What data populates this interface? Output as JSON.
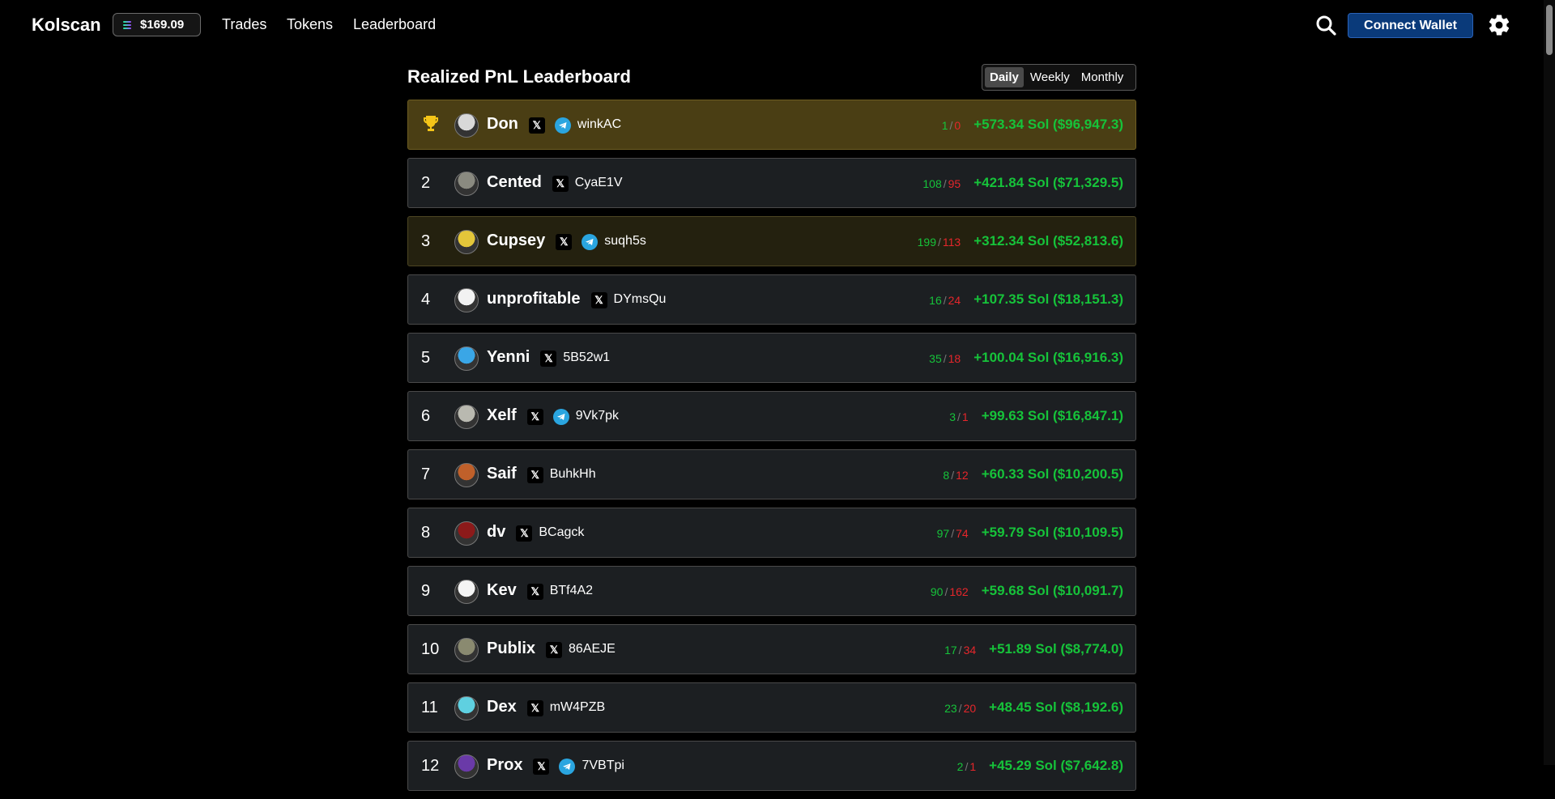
{
  "app": {
    "brand": "Kolscan",
    "sol_price": "$169.09"
  },
  "nav": [
    "Trades",
    "Tokens",
    "Leaderboard"
  ],
  "header": {
    "connect_label": "Connect Wallet"
  },
  "leaderboard": {
    "title": "Realized PnL Leaderboard",
    "periods": [
      "Daily",
      "Weekly",
      "Monthly"
    ],
    "active_period": "Daily",
    "rows": [
      {
        "rank": "1",
        "name": "Don",
        "x": true,
        "tg": true,
        "wallet": "winkAC",
        "wins": "1",
        "losses": "0",
        "pnl": "+573.34 Sol ($96,947.3)",
        "style": "gold",
        "avatar_color": "#d8d8d8"
      },
      {
        "rank": "2",
        "name": "Cented",
        "x": true,
        "tg": false,
        "wallet": "CyaE1V",
        "wins": "108",
        "losses": "95",
        "pnl": "+421.84 Sol ($71,329.5)",
        "style": "normal",
        "avatar_color": "#8a8a80"
      },
      {
        "rank": "3",
        "name": "Cupsey",
        "x": true,
        "tg": true,
        "wallet": "suqh5s",
        "wins": "199",
        "losses": "113",
        "pnl": "+312.34 Sol ($52,813.6)",
        "style": "olive",
        "avatar_color": "#e3c63a"
      },
      {
        "rank": "4",
        "name": "unprofitable",
        "x": true,
        "tg": false,
        "wallet": "DYmsQu",
        "wins": "16",
        "losses": "24",
        "pnl": "+107.35 Sol ($18,151.3)",
        "style": "normal",
        "avatar_color": "#f2f2f2"
      },
      {
        "rank": "5",
        "name": "Yenni",
        "x": true,
        "tg": false,
        "wallet": "5B52w1",
        "wins": "35",
        "losses": "18",
        "pnl": "+100.04 Sol ($16,916.3)",
        "style": "normal",
        "avatar_color": "#3aa6e6"
      },
      {
        "rank": "6",
        "name": "Xelf",
        "x": true,
        "tg": true,
        "wallet": "9Vk7pk",
        "wins": "3",
        "losses": "1",
        "pnl": "+99.63 Sol ($16,847.1)",
        "style": "normal",
        "avatar_color": "#b9b9b0"
      },
      {
        "rank": "7",
        "name": "Saif",
        "x": true,
        "tg": false,
        "wallet": "BuhkHh",
        "wins": "8",
        "losses": "12",
        "pnl": "+60.33 Sol ($10,200.5)",
        "style": "normal",
        "avatar_color": "#c0602a"
      },
      {
        "rank": "8",
        "name": "dv",
        "x": true,
        "tg": false,
        "wallet": "BCagck",
        "wins": "97",
        "losses": "74",
        "pnl": "+59.79 Sol ($10,109.5)",
        "style": "normal",
        "avatar_color": "#8c1a1a"
      },
      {
        "rank": "9",
        "name": "Kev",
        "x": true,
        "tg": false,
        "wallet": "BTf4A2",
        "wins": "90",
        "losses": "162",
        "pnl": "+59.68 Sol ($10,091.7)",
        "style": "normal",
        "avatar_color": "#f4f4f4"
      },
      {
        "rank": "10",
        "name": "Publix",
        "x": true,
        "tg": false,
        "wallet": "86AEJE",
        "wins": "17",
        "losses": "34",
        "pnl": "+51.89 Sol ($8,774.0)",
        "style": "normal",
        "avatar_color": "#8a8a70"
      },
      {
        "rank": "11",
        "name": "Dex",
        "x": true,
        "tg": false,
        "wallet": "mW4PZB",
        "wins": "23",
        "losses": "20",
        "pnl": "+48.45 Sol ($8,192.6)",
        "style": "normal",
        "avatar_color": "#5fd0e0"
      },
      {
        "rank": "12",
        "name": "Prox",
        "x": true,
        "tg": true,
        "wallet": "7VBTpi",
        "wins": "2",
        "losses": "1",
        "pnl": "+45.29 Sol ($7,642.8)",
        "style": "normal",
        "avatar_color": "#6a3aa8"
      }
    ]
  },
  "icons": {
    "search": "search-icon",
    "settings": "gear-icon",
    "first_place": "trophy-icon",
    "twitter": "x-icon",
    "telegram": "telegram-icon",
    "sol": "solana-icon"
  },
  "colors": {
    "win": "#16c33a",
    "loss": "#e5262b",
    "connect_bg": "#0a3a7a",
    "first_row_bg": "#4a3e14",
    "third_row_bg": "#24210f",
    "row_bg": "#1c1f22"
  }
}
